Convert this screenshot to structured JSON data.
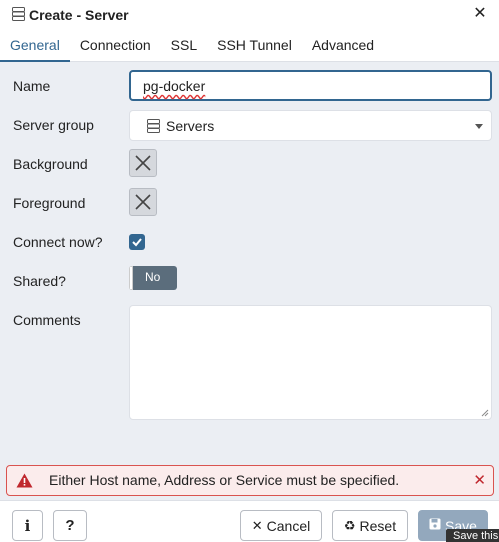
{
  "dialog": {
    "title": "Create - Server",
    "close_icon": "close-icon",
    "title_icon": "server-group-icon"
  },
  "tabs": [
    {
      "label": "General",
      "active": true
    },
    {
      "label": "Connection",
      "active": false
    },
    {
      "label": "SSL",
      "active": false
    },
    {
      "label": "SSH Tunnel",
      "active": false
    },
    {
      "label": "Advanced",
      "active": false
    }
  ],
  "form": {
    "name": {
      "label": "Name",
      "value": "pg-docker"
    },
    "server_group": {
      "label": "Server group",
      "value": "Servers"
    },
    "background": {
      "label": "Background"
    },
    "foreground": {
      "label": "Foreground"
    },
    "connect_now": {
      "label": "Connect now?",
      "checked": true
    },
    "shared": {
      "label": "Shared?",
      "value": "No"
    },
    "comments": {
      "label": "Comments",
      "value": ""
    }
  },
  "alert": {
    "message": "Either Host name, Address or Service must be specified.",
    "icon": "warning-icon"
  },
  "footer": {
    "info_label": "i",
    "help_label": "?",
    "cancel_label": "Cancel",
    "reset_label": "Reset",
    "save_label": "Save",
    "tooltip": "Save this"
  },
  "colors": {
    "accent": "#326690",
    "error": "#d9534f",
    "background": "#ebeef3"
  }
}
